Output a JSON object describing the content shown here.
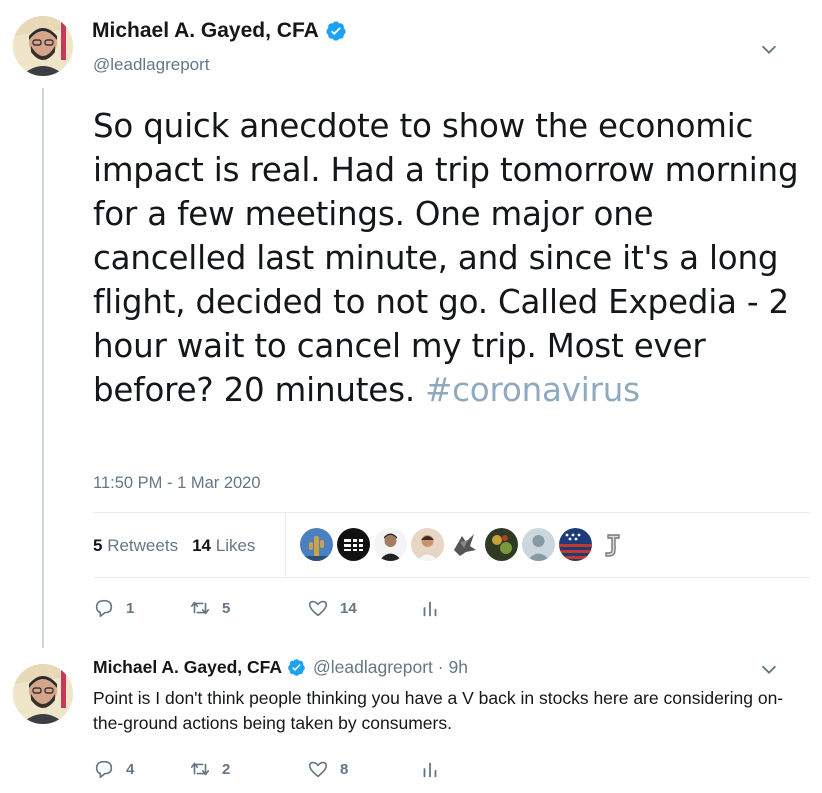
{
  "tweet": {
    "author_name": "Michael A. Gayed, CFA",
    "handle": "@leadlagreport",
    "text": "So quick anecdote to show the economic impact is real. Had a trip tomorrow morning for a few meetings. One major one cancelled last minute, and since it's a long flight, decided to not go. Called Expedia - 2 hour wait to cancel my trip. Most ever before? 20 minutes.",
    "hashtag": "#coronavirus",
    "timestamp": "11:50 PM - 1 Mar 2020",
    "retweets_count": "5",
    "retweets_label": "Retweets",
    "likes_count": "14",
    "likes_label": "Likes",
    "actions": {
      "reply": "1",
      "retweet": "5",
      "like": "14"
    }
  },
  "reply": {
    "author_name": "Michael A. Gayed, CFA",
    "meta": "@leadlagreport · 9h",
    "text": "Point is I don't think people thinking you have a V back in stocks here are considering on-the-ground actions being taken by consumers.",
    "actions": {
      "reply": "4",
      "retweet": "2",
      "like": "8"
    }
  },
  "colors": {
    "verified": "#1da1f2",
    "hashtag": "#8fa9bf",
    "muted": "#657786",
    "text": "#14171a"
  },
  "liker_avatars": [
    "cactus-avatar",
    "logo-avatar",
    "man-avatar",
    "portrait-avatar",
    "bird-avatar",
    "colorful-avatar",
    "default-avatar",
    "flag-avatar",
    "letter-j-avatar"
  ]
}
